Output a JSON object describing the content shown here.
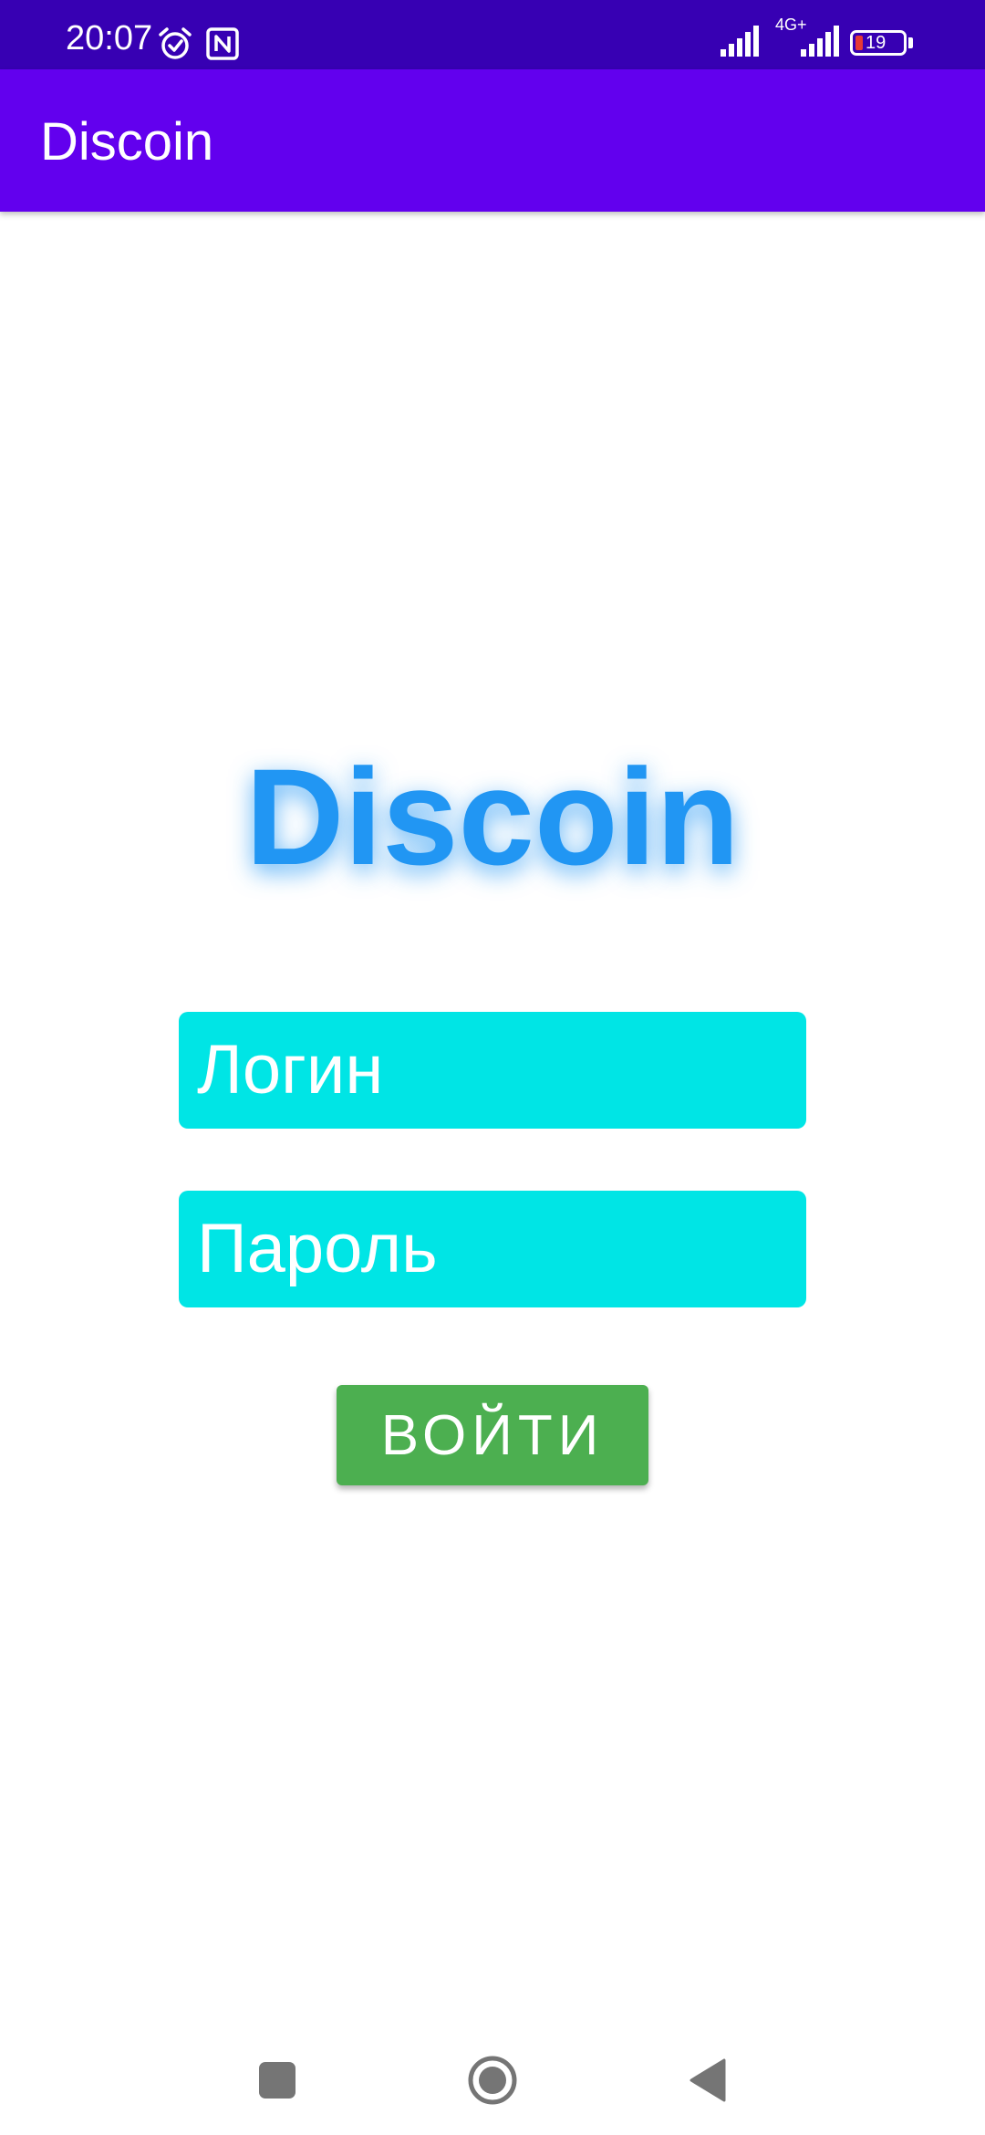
{
  "status_bar": {
    "time": "20:07",
    "network": "4G+",
    "battery": "19",
    "icons": [
      "alarm-icon",
      "nfc-icon",
      "signal-icon",
      "signal-icon",
      "battery-icon"
    ]
  },
  "app_bar": {
    "title": "Discoin"
  },
  "main": {
    "logo_text": "Discoin",
    "login_placeholder": "Логин",
    "password_placeholder": "Пароль",
    "login_button_label": "Войти"
  },
  "nav_bar": {
    "icons": [
      "recents-icon",
      "home-icon",
      "back-icon"
    ]
  },
  "colors": {
    "status_bar": "#3700b3",
    "app_bar": "#6200ee",
    "logo": "#2196f3",
    "field_background": "#00e5e5",
    "button": "#4caf50"
  }
}
